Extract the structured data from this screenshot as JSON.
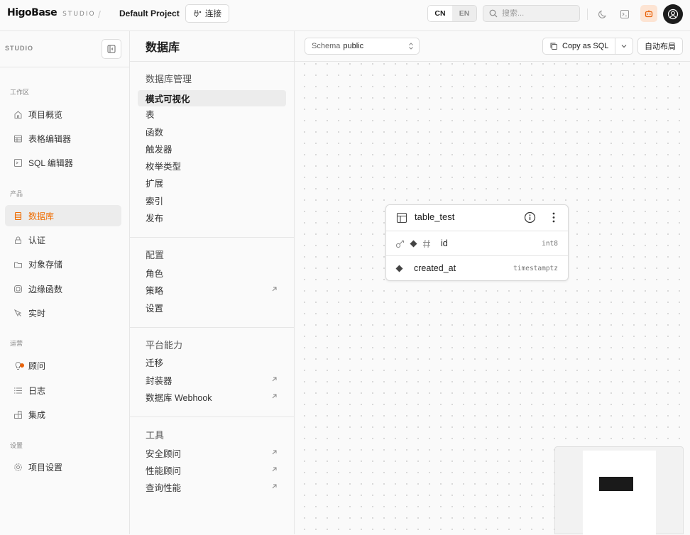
{
  "header": {
    "logo_text": "HigoBase",
    "logo_suffix": "STUDIO",
    "separator": "/",
    "project_name": "Default Project",
    "connect_label": "连接",
    "lang_cn": "CN",
    "lang_en": "EN",
    "search_placeholder": "搜索..."
  },
  "sidebar": {
    "label": "STUDIO",
    "sections": [
      {
        "title": "工作区",
        "items": [
          {
            "label": "项目概览",
            "icon": "home-icon"
          },
          {
            "label": "表格编辑器",
            "icon": "table-icon"
          },
          {
            "label": "SQL 编辑器",
            "icon": "terminal-icon"
          }
        ]
      },
      {
        "title": "产品",
        "items": [
          {
            "label": "数据库",
            "icon": "database-icon"
          },
          {
            "label": "认证",
            "icon": "lock-icon"
          },
          {
            "label": "对象存储",
            "icon": "archive-icon"
          },
          {
            "label": "边缘函数",
            "icon": "functions-icon"
          },
          {
            "label": "实时",
            "icon": "realtime-icon"
          }
        ]
      },
      {
        "title": "运营",
        "items": [
          {
            "label": "顾问",
            "icon": "lightbulb-icon"
          },
          {
            "label": "日志",
            "icon": "list-icon"
          },
          {
            "label": "集成",
            "icon": "puzzle-icon"
          }
        ]
      },
      {
        "title": "设置",
        "items": [
          {
            "label": "项目设置",
            "icon": "gear-icon"
          }
        ]
      }
    ]
  },
  "menu": {
    "title": "数据库",
    "groups": [
      {
        "title": "数据库管理",
        "items": [
          "模式可视化",
          "表",
          "函数",
          "触发器",
          "枚举类型",
          "扩展",
          "索引",
          "发布"
        ]
      },
      {
        "title": "配置",
        "items": [
          "角色",
          "策略",
          "设置"
        ]
      },
      {
        "title": "平台能力",
        "items": [
          "迁移",
          "封装器",
          "数据库 Webhook"
        ]
      },
      {
        "title": "工具",
        "items": [
          "安全顾问",
          "性能顾问",
          "查询性能"
        ]
      }
    ]
  },
  "toolbar": {
    "schema_key": "Schema",
    "schema_value": "public",
    "copy_label": "Copy as SQL",
    "auto_layout_label": "自动布局"
  },
  "table_node": {
    "name": "table_test",
    "columns": [
      {
        "name": "id",
        "type": "int8"
      },
      {
        "name": "created_at",
        "type": "timestamptz"
      }
    ]
  },
  "colors": {
    "accent": "#ef6c00",
    "dot": "#e8620a"
  }
}
